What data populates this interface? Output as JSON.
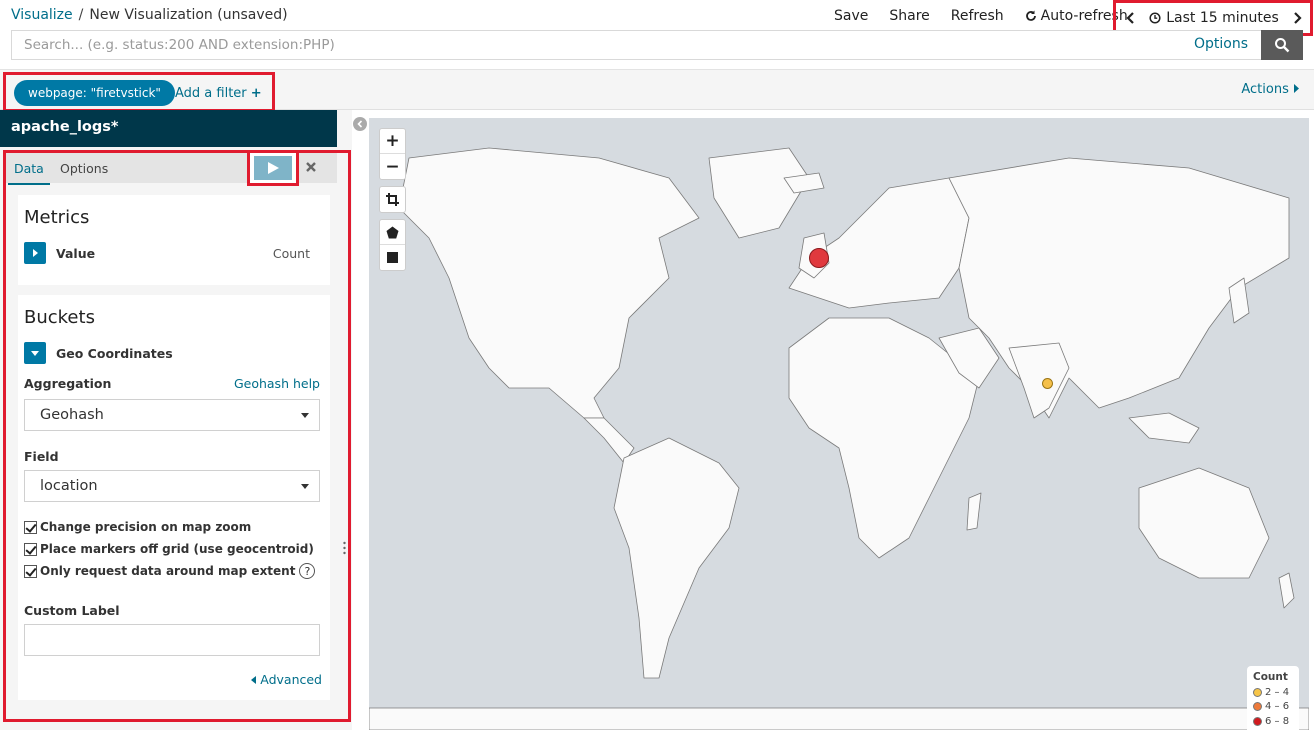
{
  "breadcrumb": {
    "root": "Visualize",
    "separator": "/",
    "current": "New Visualization (unsaved)"
  },
  "top_actions": {
    "save": "Save",
    "share": "Share",
    "refresh": "Refresh",
    "auto_refresh": "Auto-refresh"
  },
  "timepicker": {
    "label": "Last 15 minutes"
  },
  "search": {
    "placeholder": "Search... (e.g. status:200 AND extension:PHP)",
    "value": "",
    "options_label": "Options"
  },
  "filters": {
    "pill_label": "webpage: \"firetvstick\"",
    "add_label": "Add a filter",
    "add_icon": "+",
    "actions_label": "Actions"
  },
  "sidebar": {
    "index_pattern": "apache_logs*",
    "tabs": [
      {
        "label": "Data"
      },
      {
        "label": "Options"
      }
    ],
    "metrics": {
      "title": "Metrics",
      "row_label": "Value",
      "row_value": "Count"
    },
    "buckets": {
      "title": "Buckets",
      "agg_type_label": "Geo Coordinates",
      "aggregation_label": "Aggregation",
      "aggregation_help": "Geohash help",
      "aggregation_value": "Geohash",
      "field_label": "Field",
      "field_value": "location",
      "checkboxes": [
        {
          "label": "Change precision on map zoom",
          "checked": true
        },
        {
          "label": "Place markers off grid (use geocentroid)",
          "checked": true
        },
        {
          "label": "Only request data around map extent",
          "checked": true
        }
      ],
      "custom_label_label": "Custom Label",
      "custom_label_value": "",
      "advanced_label": "Advanced"
    }
  },
  "map": {
    "controls": {
      "zoom_in": "+",
      "zoom_out": "−"
    },
    "markers": [
      {
        "name": "uk-marker",
        "color": "#e0393e"
      },
      {
        "name": "india-marker",
        "color": "#f5c04a"
      }
    ],
    "legend": {
      "title": "Count",
      "items": [
        {
          "label": "2 – 4",
          "color": "#f7c548"
        },
        {
          "label": "4 – 6",
          "color": "#ee7a3a"
        },
        {
          "label": "6 – 8",
          "color": "#d11a1f"
        }
      ]
    }
  },
  "colors": {
    "accent": "#006e8a",
    "pill": "#0079a5",
    "header_dark": "#00374a",
    "highlight": "#e01b2f"
  }
}
